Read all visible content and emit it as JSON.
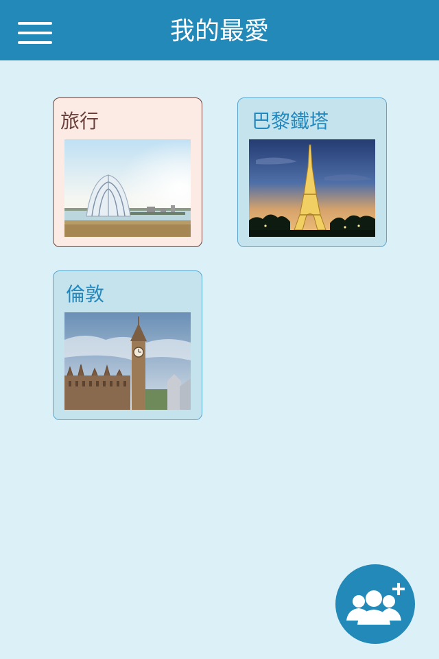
{
  "header": {
    "title": "我的最愛",
    "menu_icon": "hamburger-menu-icon",
    "background_color": "#2389b8"
  },
  "favorites": [
    {
      "label": "旅行",
      "image": "crystal-church-photo",
      "selected": true
    },
    {
      "label": "巴黎鐵塔",
      "image": "eiffel-tower-photo",
      "selected": false
    },
    {
      "label": "倫敦",
      "image": "big-ben-photo",
      "selected": false
    }
  ],
  "fab": {
    "icon": "add-group-icon",
    "color": "#2389b8"
  },
  "colors": {
    "page_background": "#dcf0f7",
    "selected_card": "#fcebe5",
    "card": "#c5e3ed",
    "card_label": "#2388bd"
  }
}
